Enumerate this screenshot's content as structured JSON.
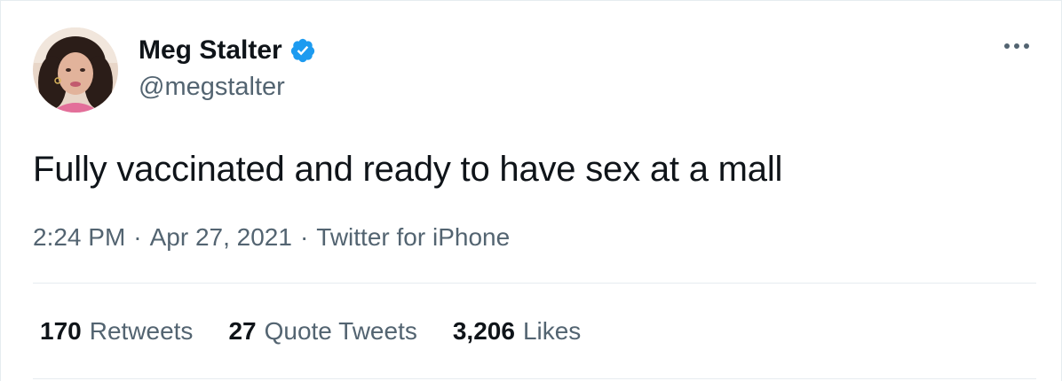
{
  "author": {
    "name": "Meg Stalter",
    "handle": "@megstalter",
    "verified": true,
    "verified_color": "#1d9bf0"
  },
  "tweet": {
    "text": "Fully vaccinated and ready to have sex at a mall"
  },
  "meta": {
    "time": "2:24 PM",
    "separator": "·",
    "date": "Apr 27, 2021",
    "source": "Twitter for iPhone"
  },
  "stats": [
    {
      "count": "170",
      "label": "Retweets"
    },
    {
      "count": "27",
      "label": "Quote Tweets"
    },
    {
      "count": "3,206",
      "label": "Likes"
    }
  ],
  "icons": {
    "more": "more-horizontal-icon",
    "verified": "verified-badge-icon"
  }
}
